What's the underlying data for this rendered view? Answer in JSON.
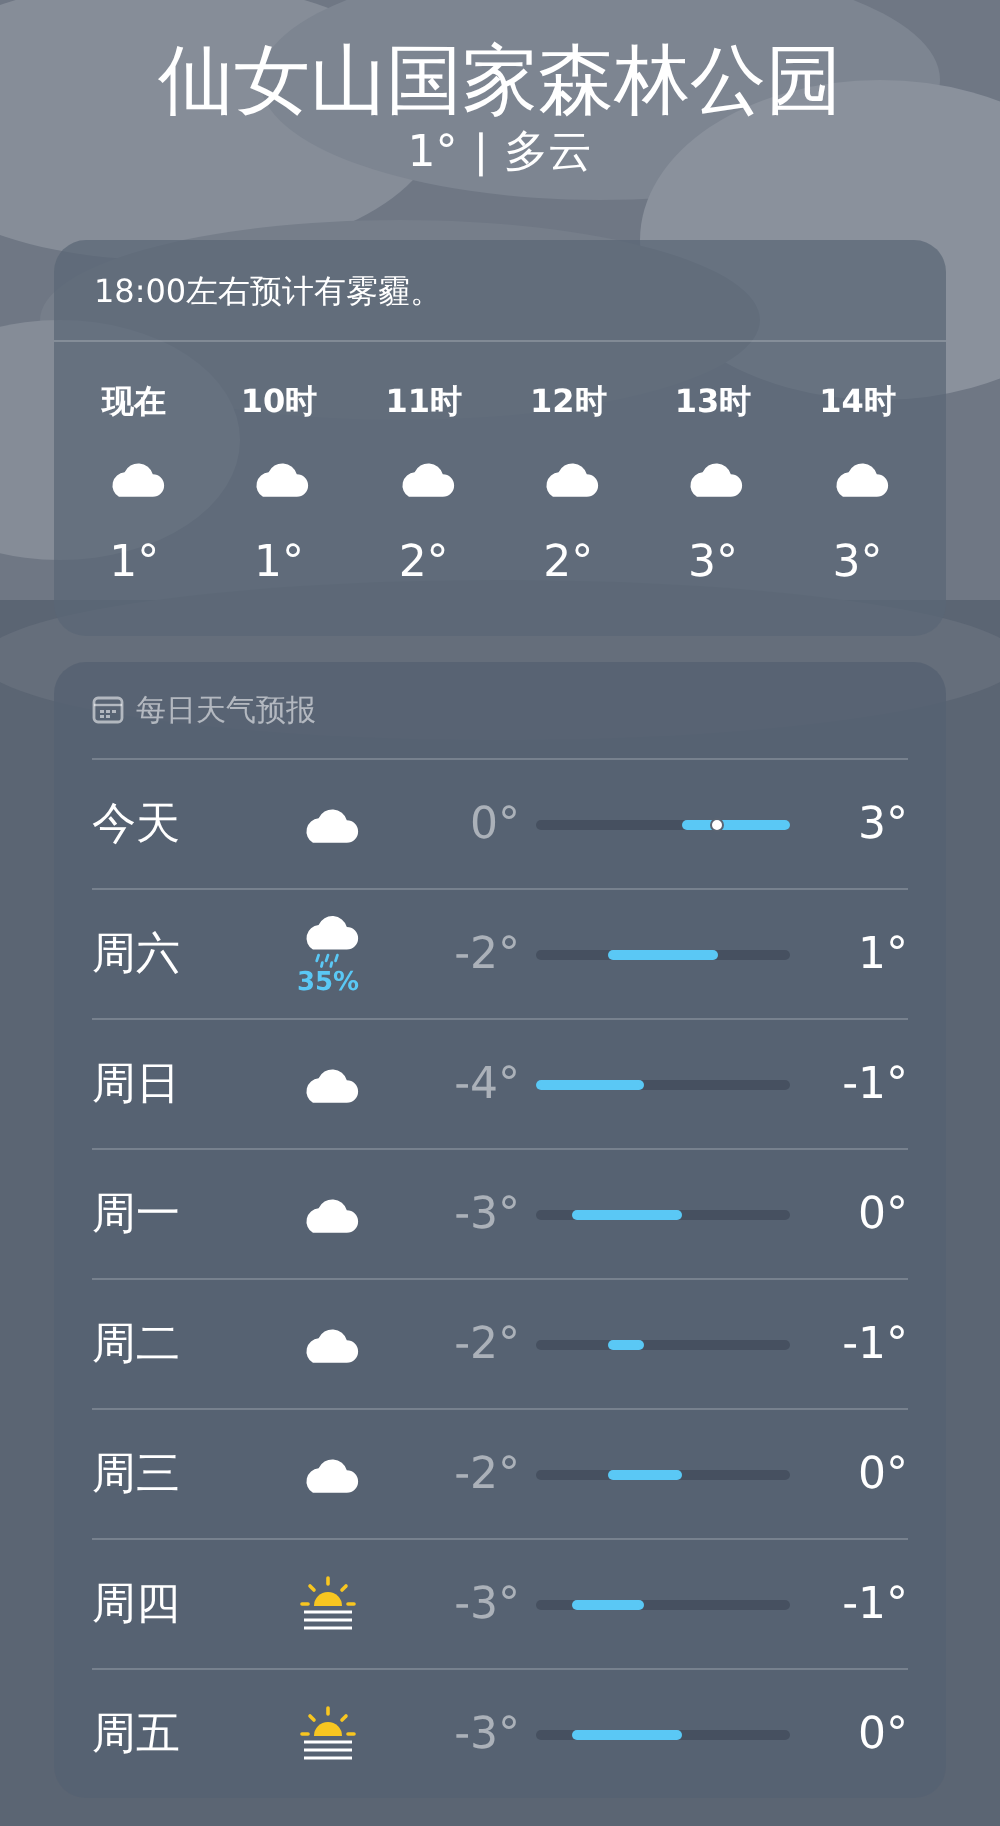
{
  "location": "仙女山国家森林公园",
  "current": {
    "temperature": "1°",
    "separator": "|",
    "condition": "多云"
  },
  "hourly": {
    "summary": "18:00左右预计有雾霾。",
    "hours": [
      {
        "time": "现在",
        "kind": "cloudy",
        "temperature": "1°"
      },
      {
        "time": "10时",
        "kind": "cloudy",
        "temperature": "1°"
      },
      {
        "time": "11时",
        "kind": "cloudy",
        "temperature": "2°"
      },
      {
        "time": "12时",
        "kind": "cloudy",
        "temperature": "2°"
      },
      {
        "time": "13时",
        "kind": "cloudy",
        "temperature": "3°"
      },
      {
        "time": "14时",
        "kind": "cloudy",
        "temperature": "3°"
      }
    ]
  },
  "daily": {
    "title": "每日天气预报",
    "days": [
      {
        "day": "今天",
        "kind": "cloudy",
        "low": "0°",
        "high": "3°",
        "now_marker": true
      },
      {
        "day": "周六",
        "kind": "rain",
        "precipitation": "35%",
        "low": "-2°",
        "high": "1°",
        "now_marker": false
      },
      {
        "day": "周日",
        "kind": "cloudy",
        "low": "-4°",
        "high": "-1°",
        "now_marker": false
      },
      {
        "day": "周一",
        "kind": "cloudy",
        "low": "-3°",
        "high": "0°",
        "now_marker": false
      },
      {
        "day": "周二",
        "kind": "cloudy",
        "low": "-2°",
        "high": "-1°",
        "now_marker": false
      },
      {
        "day": "周三",
        "kind": "cloudy",
        "low": "-2°",
        "high": "0°",
        "now_marker": false
      },
      {
        "day": "周四",
        "kind": "haze",
        "low": "-3°",
        "high": "-1°",
        "now_marker": false
      },
      {
        "day": "周五",
        "kind": "haze",
        "low": "-3°",
        "high": "0°",
        "now_marker": false
      }
    ]
  }
}
